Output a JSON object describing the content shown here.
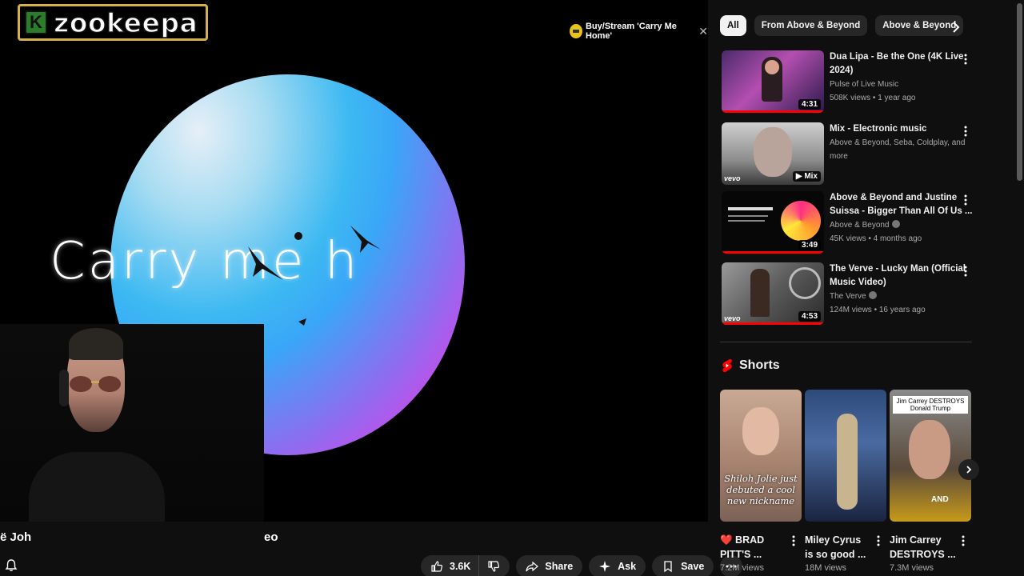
{
  "channel_logo": {
    "letter": "K",
    "text": "zookeepa"
  },
  "player": {
    "lyric_text": "Carry me h",
    "buy_pill": "Buy/Stream 'Carry Me Home'",
    "title_left_fragment": "ë Joh",
    "title_right_fragment": "eo"
  },
  "actions": {
    "like_count": "3.6K",
    "share": "Share",
    "ask": "Ask",
    "save": "Save"
  },
  "chips": [
    "All",
    "From Above & Beyond",
    "Above & Beyond"
  ],
  "recommendations": [
    {
      "title": "Dua Lipa - Be the One (4K Live 2024)",
      "channel": "Pulse of Live Music",
      "stats": "508K views • 1 year ago",
      "duration": "4:31",
      "verified": false
    },
    {
      "title": "Mix - Electronic music",
      "channel": "Above & Beyond, Seba, Coldplay, and more",
      "stats": "",
      "duration": "Mix",
      "verified": false
    },
    {
      "title": "Above & Beyond and Justine Suissa - Bigger Than All Of Us ...",
      "channel": "Above & Beyond",
      "stats": "45K views • 4 months ago",
      "duration": "3:49",
      "verified": true
    },
    {
      "title": "The Verve - Lucky Man (Official Music Video)",
      "channel": "The Verve",
      "stats": "124M views • 16 years ago",
      "duration": "4:53",
      "verified": true
    }
  ],
  "shorts": {
    "heading": "Shorts",
    "items": [
      {
        "title": "❤️ BRAD PITT'S ...",
        "views": "7.2M views",
        "caption": "Shiloh Jolie just debuted a cool new nickname"
      },
      {
        "title": "Miley Cyrus is so good ...",
        "views": "18M views",
        "caption": ""
      },
      {
        "title": "Jim Carrey DESTROYS ...",
        "views": "7.3M views",
        "caption": "Jim Carrey DESTROYS Donald Trump",
        "badge": "AND"
      }
    ]
  },
  "colors": {
    "accent_red": "#ff0000",
    "logo_border": "#d7b04a",
    "buy_yellow": "#e9c31a"
  }
}
